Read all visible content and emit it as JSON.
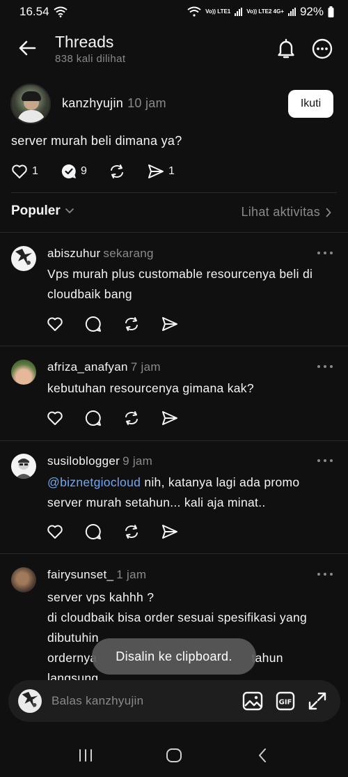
{
  "status_bar": {
    "time": "16.54",
    "sim1": "Vo)) LTE1",
    "sim2": "Vo)) LTE2 4G+",
    "battery": "92%"
  },
  "header": {
    "title": "Threads",
    "subtitle": "838 kali dilihat"
  },
  "post": {
    "username": "kanzhyujin",
    "time": "10 jam",
    "follow_label": "Ikuti",
    "text": "server murah beli dimana ya?",
    "likes": "1",
    "replies": "9",
    "shares": "1"
  },
  "sort": {
    "label": "Populer",
    "activity_label": "Lihat aktivitas"
  },
  "replies": [
    {
      "username": "abiszuhur",
      "time": "sekarang",
      "text": "Vps murah plus customable resourcenya beli di\ncloudbaik bang"
    },
    {
      "username": "afriza_anafyan",
      "time": "7 jam",
      "text": "kebutuhan resourcenya gimana kak?"
    },
    {
      "username": "susiloblogger",
      "time": "9 jam",
      "mention": "@biznetgiocloud",
      "text": " nih, katanya lagi ada promo\nserver murah setahun... kali aja minat.."
    },
    {
      "username": "fairysunset_",
      "time": "1 jam",
      "text_line1": "server vps kahhh ?",
      "text_line2": "di cloudbaik bisa order sesuai spesifikasi yang",
      "text_line3": "dibutuhin",
      "text_line4": "ordernya",
      "text_line4_tail": "tahun",
      "text_line5": "langsung"
    }
  ],
  "toast": "Disalin ke clipboard.",
  "composer": {
    "placeholder": "Balas kanzhyujin",
    "gif_label": "GIF"
  },
  "colors": {
    "background": "#101010",
    "text": "#f3f5f7",
    "muted": "#8a8a8a",
    "mention": "#6fa8f5"
  }
}
